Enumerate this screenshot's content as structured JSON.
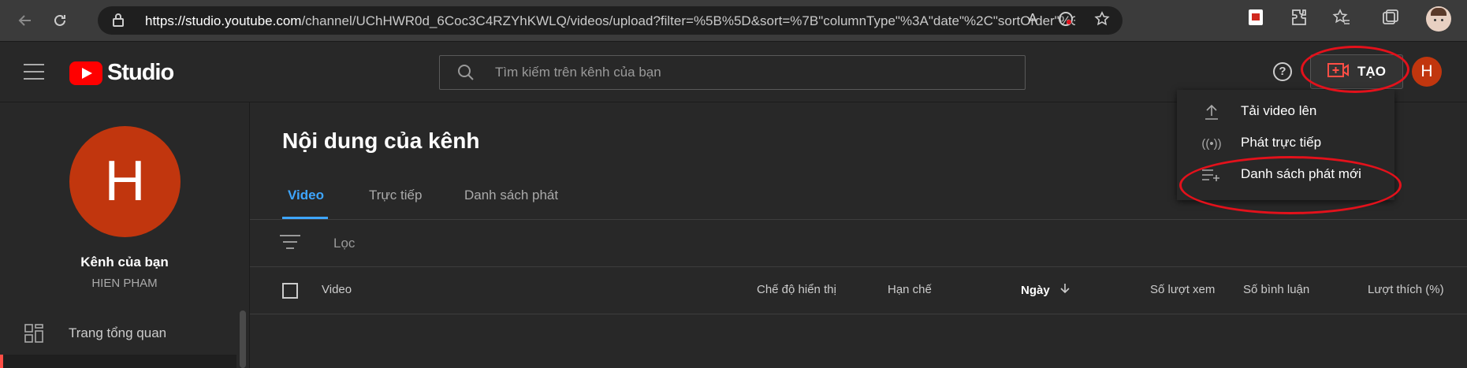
{
  "browser": {
    "url_host": "https://studio.youtube.com",
    "url_path": "/channel/UChHWR0d_6Coc3C4RZYhKWLQ/videos/upload?filter=%5B%5D&sort=%7B\"columnType\"%3A\"date\"%2C\"sortOrder\"%3A...",
    "read_aloud_label": "A"
  },
  "header": {
    "logo_text": "Studio",
    "search_placeholder": "Tìm kiếm trên kênh của bạn",
    "help_label": "?",
    "create_label": "TẠO",
    "avatar_letter": "H"
  },
  "create_menu": {
    "items": [
      {
        "label": "Tải video lên",
        "icon": "upload-icon"
      },
      {
        "label": "Phát trực tiếp",
        "icon": "live-icon"
      },
      {
        "label": "Danh sách phát mới",
        "icon": "playlist-add-icon"
      }
    ]
  },
  "sidebar": {
    "channel_letter": "H",
    "channel_title": "Kênh của bạn",
    "channel_name": "HIEN PHAM",
    "items": [
      {
        "label": "Trang tổng quan",
        "icon": "dashboard-icon"
      }
    ]
  },
  "main": {
    "title": "Nội dung của kênh",
    "tabs": [
      {
        "label": "Video",
        "active": true
      },
      {
        "label": "Trực tiếp",
        "active": false
      },
      {
        "label": "Danh sách phát",
        "active": false
      }
    ],
    "filter_label": "Lọc",
    "columns": [
      "Video",
      "Chế độ hiển thị",
      "Hạn chế",
      "Ngày",
      "Số lượt xem",
      "Số bình luận",
      "Lượt thích (%)"
    ],
    "sort_column": "Ngày"
  },
  "colors": {
    "accent": "#3ea6ff",
    "brand_red": "#ff0000",
    "avatar": "#c1360e",
    "annotation": "#e3111b"
  }
}
